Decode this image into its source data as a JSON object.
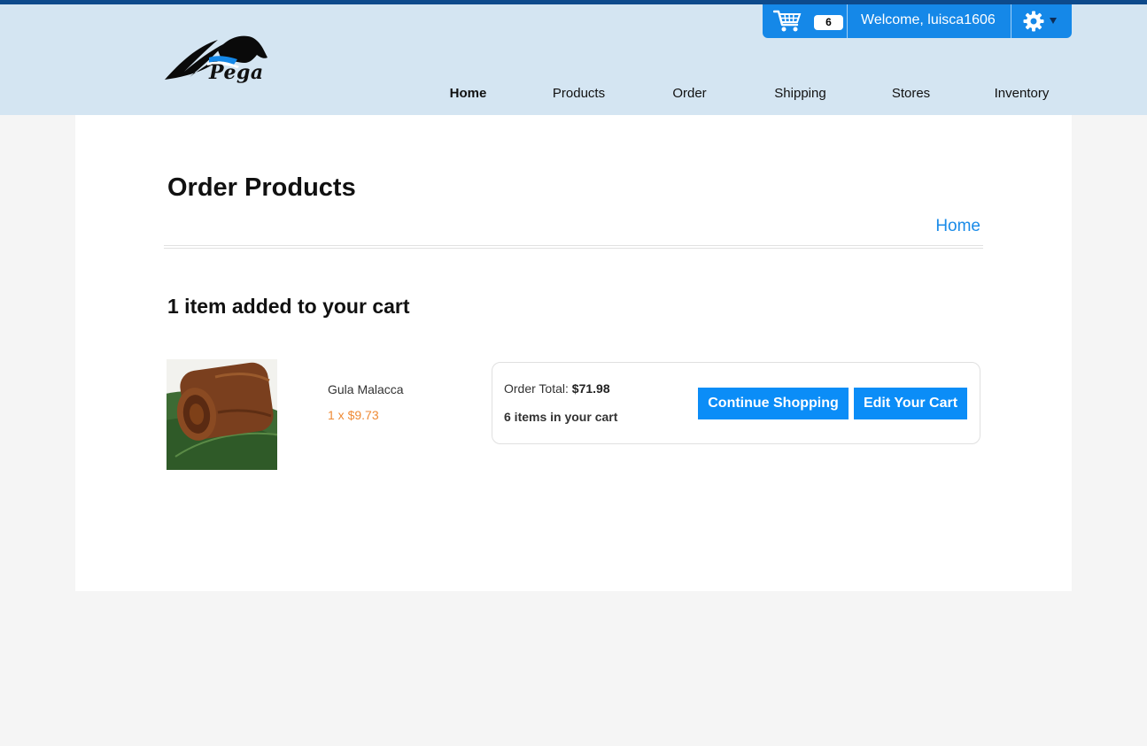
{
  "brand": {
    "name": "Pega"
  },
  "userbar": {
    "cart_count": "6",
    "welcome": "Welcome, luisca1606"
  },
  "nav": {
    "items": [
      {
        "label": "Home",
        "active": true
      },
      {
        "label": "Products"
      },
      {
        "label": "Order"
      },
      {
        "label": "Shipping"
      },
      {
        "label": "Stores"
      },
      {
        "label": "Inventory"
      }
    ]
  },
  "page": {
    "title": "Order Products",
    "breadcrumb": "Home"
  },
  "cart_added": {
    "heading": "1 item added to your cart",
    "product": {
      "name": "Gula Malacca",
      "qty_price": "1 x $9.73"
    }
  },
  "summary": {
    "total_label": "Order Total:",
    "total_value": "$71.98",
    "items_text": "6 items in your cart",
    "continue_label": "Continue Shopping",
    "edit_label": "Edit Your Cart"
  },
  "colors": {
    "accent": "#1588e8",
    "header_bg": "#d4e5f2",
    "price": "#ef8a34",
    "link": "#1a8be8"
  }
}
